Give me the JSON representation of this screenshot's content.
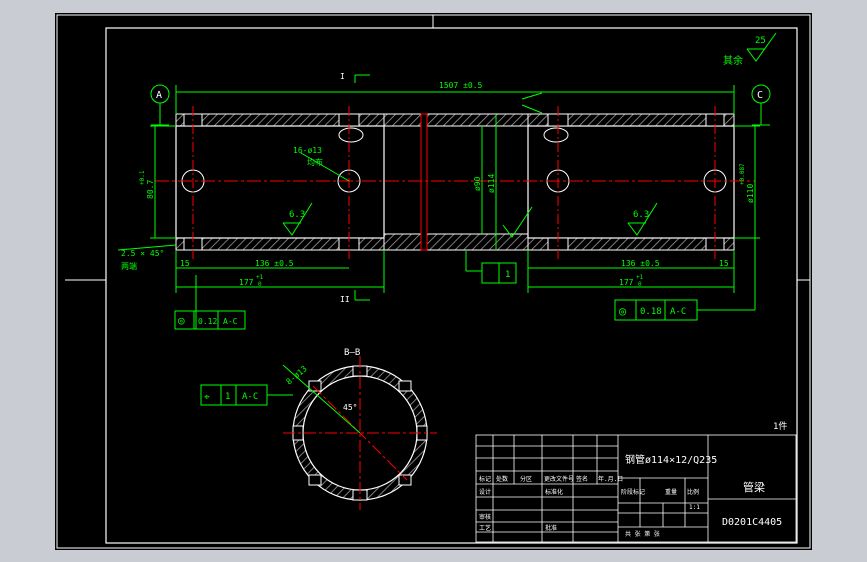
{
  "drawing": {
    "sections": {
      "top_marker": "I",
      "bottom_marker": "II",
      "section_view_label": "B—B"
    },
    "datums": {
      "left": "A",
      "right": "C"
    },
    "roughness": {
      "other": "其余",
      "other_value": "25",
      "left_value": "6.3",
      "right_value": "6.3"
    },
    "dimensions": {
      "overall_length": "1507 ±0.5",
      "left_hole_spacing": "136 ±0.5",
      "right_hole_spacing": "136 ±0.5",
      "left_end_offset": "15",
      "right_end_offset": "15",
      "left_bay": "177",
      "right_bay": "177",
      "bay_tolerance": "+1",
      "bay_tolerance_lower": "0",
      "left_height": "80.7",
      "left_height_tol": "+0.1",
      "right_height": "ø110",
      "right_height_tol": "+0.087",
      "mid_bore": "ø90",
      "mid_outer": "ø114",
      "chamfer": "2.5 × 45°",
      "chamfer_note": "两端",
      "hole_note": "16-ø13",
      "hole_note2": "均布",
      "section_hole": "8-ø13",
      "section_angle": "45°"
    },
    "tolerance_frames": {
      "left_symbol": "◎",
      "left_value": "0.12",
      "left_datum": "A-C",
      "right_symbol": "◎",
      "right_value": "0.18",
      "right_datum": "A-C",
      "weld_value": "1",
      "section_symbol": "⌖",
      "section_value": "1",
      "section_datum": "A-C"
    },
    "title_block": {
      "material": "钢管ø114×12/Q235",
      "part_name": "管梁",
      "drawing_number": "D0201C4405",
      "scale": "1:1",
      "sheet_count": "1件",
      "labels": {
        "mark": "标记",
        "count": "处数",
        "zone": "分区",
        "change_doc": "更改文件号",
        "signature": "签名",
        "date": "年.月.日",
        "design": "设计",
        "standard": "标准化",
        "stage_mark": "阶段标记",
        "weight": "重量",
        "scale_label": "比例",
        "review": "审核",
        "process": "工艺",
        "approve": "批准",
        "sheet": "共 张 第 张"
      }
    },
    "colors": {
      "background": "#000000",
      "window": "#c9cdd3",
      "lines": "#ffffff",
      "dimensions": "#00ff00",
      "centerlines": "#ff0000",
      "hatch": "#888888"
    }
  }
}
